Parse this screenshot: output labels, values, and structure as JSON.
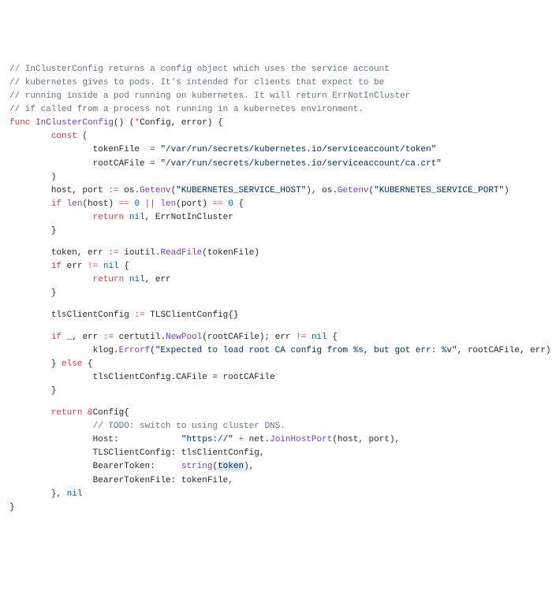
{
  "comments": {
    "c1": "// InClusterConfig returns a config object which uses the service account",
    "c2": "// kubernetes gives to pods. It's intended for clients that expect to be",
    "c3": "// running inside a pod running on kubernetes. It will return ErrNotInCluster",
    "c4": "// if called from a process not running in a kubernetes environment.",
    "todo": "// TODO: switch to using cluster DNS."
  },
  "kw": {
    "func": "func",
    "const": "const",
    "if": "if",
    "else": "else",
    "return": "return",
    "nil": "nil"
  },
  "fn": {
    "name": "InClusterConfig",
    "retType1": "Config",
    "retType2": "error"
  },
  "consts": {
    "tokenFileName": "tokenFile",
    "tokenFileEq": "  = ",
    "tokenFileVal": "\"/var/run/secrets/kubernetes.io/serviceaccount/token\"",
    "rootCAFileName": "rootCAFile",
    "rootCAFileEq": " = ",
    "rootCAFileVal": "\"/var/run/secrets/kubernetes.io/serviceaccount/ca.crt\""
  },
  "hostport": {
    "hostVar": "host",
    "portVar": "port",
    "assign": " := ",
    "os1": "os",
    "getenv1": "Getenv",
    "envHost": "\"KUBERNETES_SERVICE_HOST\"",
    "os2": "os",
    "getenv2": "Getenv",
    "envPort": "\"KUBERNETES_SERVICE_PORT\""
  },
  "lenCheck": {
    "len1": "len",
    "hostRef": "host",
    "eq1": " == ",
    "zero1": "0",
    "or": " || ",
    "len2": "len",
    "portRef": "port",
    "eq2": " == ",
    "zero2": "0",
    "errNotInCluster": "ErrNotInCluster"
  },
  "tokenRead": {
    "tokenVar": "token",
    "errVar": "err",
    "assign": " := ",
    "ioutil": "ioutil",
    "readFile": "ReadFile",
    "arg": "tokenFile"
  },
  "errCheck1": {
    "errRef": "err",
    "neq": " != ",
    "errRet": "err"
  },
  "tlsDecl": {
    "varName": "tlsClientConfig",
    "assign": " := ",
    "typeName": "TLSClientConfig"
  },
  "poolCheck": {
    "blank": "_",
    "errVar": "err",
    "assign": " := ",
    "certutil": "certutil",
    "newPool": "NewPool",
    "arg": "rootCAFile",
    "errRef": "err",
    "neq": " != "
  },
  "klog": {
    "pkg": "klog",
    "errorf": "Errorf",
    "fmt": "\"Expected to load root CA config from %s, but got err: %v\"",
    "arg1": "rootCAFile",
    "arg2": "err"
  },
  "caAssign": {
    "lhs": "tlsClientConfig.CAFile",
    "eq": " = ",
    "rhs": "rootCAFile"
  },
  "retConfig": {
    "amp": "&",
    "configType": "Config",
    "hostKey": "Host:            ",
    "httpsStr": "\"https://\"",
    "plus": " + ",
    "net": "net",
    "joinHostPort": "JoinHostPort",
    "hostArg": "host",
    "portArg": "port",
    "tlsKey": "TLSClientConfig: ",
    "tlsVal": "tlsClientConfig",
    "bearerKey": "BearerToken:     ",
    "stringFn": "string",
    "tokenArg": "token",
    "bearerFileKey": "BearerTokenFile: ",
    "bearerFileVal": "tokenFile"
  }
}
